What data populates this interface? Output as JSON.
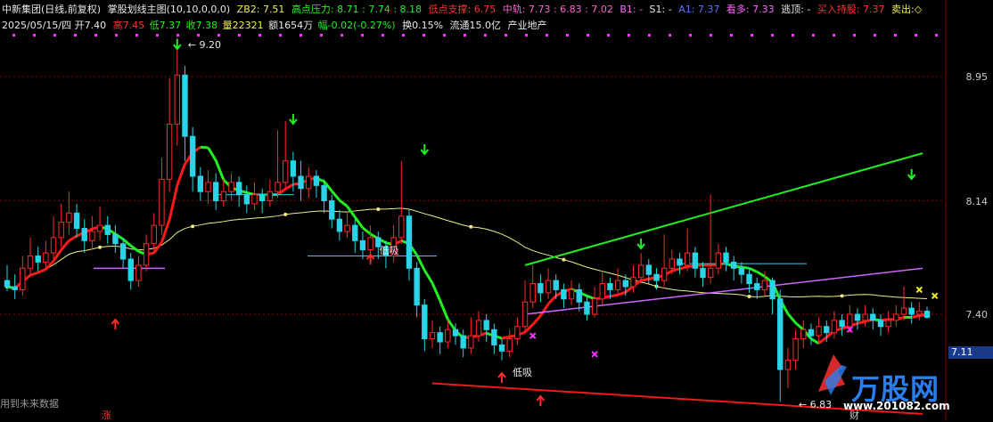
{
  "header": {
    "stock_name": "中新集团(日线,前复权)",
    "indicator_name": "掌股划线主图(10,10,0,0,0)",
    "zb2": "ZB2: 7.51",
    "high_pressure_label": "高点压力:",
    "high_pressure_values": "8.71 : 7.74 : 8.18",
    "low_support": "低点支撑: 6.75",
    "mid_track_label": "中轨:",
    "mid_track_values": "7.73 : 6.83 : 7.02",
    "b1": "B1: -",
    "s1": "S1: -",
    "a1": "A1: 7.37",
    "kan_duo": "看多: 7.33",
    "tao_ding": "逃顶: -",
    "buy_hold": "买入持股: 7.37",
    "sell_out": "卖出:◇"
  },
  "quote": {
    "date": "2025/05/15/四",
    "open": "开7.40",
    "high": "高7.45",
    "low": "低7.37",
    "close": "收7.38",
    "volume": "量22321",
    "amount": "额1654万",
    "change": "幅-0.02(-0.27%)",
    "turnover": "换0.15%",
    "float": "流通15.0亿",
    "sector": "产业地产"
  },
  "footer": {
    "note": "用到未来数据",
    "zhang": "涨",
    "cai": "财"
  },
  "logo": {
    "text": "万股网",
    "url": "www.201082.com"
  },
  "colors": {
    "background": "#000000",
    "up": "#ff2a2a",
    "down": "#2ad4e6",
    "ma_red": "#ff1a1a",
    "ma_green": "#22ee22",
    "long_ma": "#eeee88",
    "channel_upper": "#22ee22",
    "channel_lower": "#ee1a1a",
    "purple_line": "#cc66ff",
    "cyan_line": "#33ccee",
    "grid": "#8b0000"
  },
  "chart_data": {
    "type": "candlestick",
    "y_axis_ticks": [
      "8.95",
      "8.14",
      "7.40"
    ],
    "last_price_label": "7.11",
    "annotations": {
      "high_label": "9.20",
      "low_label": "6.83",
      "low_buy_label_1": "低吸",
      "low_buy_label_2": "低吸"
    },
    "candles": [
      [
        7.62,
        7.58,
        7.72,
        7.55
      ],
      [
        7.58,
        7.56,
        7.66,
        7.5
      ],
      [
        7.56,
        7.7,
        7.78,
        7.52
      ],
      [
        7.7,
        7.78,
        7.9,
        7.66
      ],
      [
        7.78,
        7.74,
        7.84,
        7.68
      ],
      [
        7.74,
        7.8,
        7.88,
        7.7
      ],
      [
        7.8,
        7.9,
        8.04,
        7.76
      ],
      [
        7.9,
        8.0,
        8.12,
        7.84
      ],
      [
        8.0,
        8.06,
        8.2,
        7.92
      ],
      [
        8.06,
        7.96,
        8.12,
        7.9
      ],
      [
        7.96,
        7.88,
        8.02,
        7.8
      ],
      [
        7.88,
        7.94,
        8.04,
        7.82
      ],
      [
        7.94,
        7.98,
        8.1,
        7.88
      ],
      [
        7.98,
        7.92,
        8.04,
        7.86
      ],
      [
        7.92,
        7.86,
        7.98,
        7.8
      ],
      [
        7.86,
        7.76,
        7.9,
        7.7
      ],
      [
        7.76,
        7.62,
        7.8,
        7.56
      ],
      [
        7.62,
        7.72,
        7.78,
        7.58
      ],
      [
        7.72,
        7.86,
        7.92,
        7.68
      ],
      [
        7.86,
        7.98,
        8.06,
        7.8
      ],
      [
        7.98,
        8.28,
        8.42,
        7.92
      ],
      [
        8.28,
        8.64,
        8.94,
        8.2
      ],
      [
        8.64,
        8.96,
        9.2,
        8.5
      ],
      [
        8.96,
        8.56,
        9.02,
        8.4
      ],
      [
        8.56,
        8.3,
        8.62,
        8.2
      ],
      [
        8.3,
        8.2,
        8.36,
        8.14
      ],
      [
        8.2,
        8.26,
        8.34,
        8.12
      ],
      [
        8.26,
        8.14,
        8.32,
        8.08
      ],
      [
        8.14,
        8.2,
        8.28,
        8.1
      ],
      [
        8.2,
        8.26,
        8.32,
        8.14
      ],
      [
        8.26,
        8.18,
        8.3,
        8.1
      ],
      [
        8.18,
        8.12,
        8.24,
        8.06
      ],
      [
        8.12,
        8.18,
        8.26,
        8.08
      ],
      [
        8.18,
        8.14,
        8.22,
        8.06
      ],
      [
        8.14,
        8.2,
        8.28,
        8.1
      ],
      [
        8.2,
        8.26,
        8.6,
        8.16
      ],
      [
        8.26,
        8.4,
        8.66,
        8.22
      ],
      [
        8.4,
        8.3,
        8.46,
        8.2
      ],
      [
        8.3,
        8.22,
        8.4,
        8.14
      ],
      [
        8.22,
        8.3,
        8.36,
        8.16
      ],
      [
        8.3,
        8.24,
        8.34,
        8.16
      ],
      [
        8.24,
        8.14,
        8.28,
        8.06
      ],
      [
        8.14,
        8.02,
        8.18,
        7.96
      ],
      [
        8.02,
        7.94,
        8.08,
        7.88
      ],
      [
        7.94,
        7.98,
        8.06,
        7.9
      ],
      [
        7.98,
        7.88,
        8.02,
        7.8
      ],
      [
        7.88,
        7.82,
        7.94,
        7.76
      ],
      [
        7.82,
        7.9,
        7.98,
        7.78
      ],
      [
        7.9,
        7.84,
        7.94,
        7.76
      ],
      [
        7.84,
        7.78,
        7.88,
        7.7
      ],
      [
        7.78,
        7.9,
        7.98,
        7.74
      ],
      [
        7.9,
        8.04,
        8.4,
        7.86
      ],
      [
        8.04,
        7.7,
        8.08,
        7.62
      ],
      [
        7.7,
        7.46,
        7.74,
        7.38
      ],
      [
        7.46,
        7.24,
        7.5,
        7.16
      ],
      [
        7.24,
        7.28,
        7.36,
        7.18
      ],
      [
        7.28,
        7.22,
        7.32,
        7.14
      ],
      [
        7.22,
        7.3,
        7.36,
        7.18
      ],
      [
        7.3,
        7.26,
        7.34,
        7.2
      ],
      [
        7.26,
        7.18,
        7.3,
        7.12
      ],
      [
        7.18,
        7.26,
        7.38,
        7.14
      ],
      [
        7.26,
        7.36,
        7.42,
        7.22
      ],
      [
        7.36,
        7.3,
        7.4,
        7.22
      ],
      [
        7.3,
        7.2,
        7.34,
        7.14
      ],
      [
        7.2,
        7.16,
        7.24,
        7.1
      ],
      [
        7.16,
        7.24,
        7.3,
        7.12
      ],
      [
        7.24,
        7.32,
        7.38,
        7.2
      ],
      [
        7.32,
        7.48,
        7.62,
        7.28
      ],
      [
        7.48,
        7.6,
        7.72,
        7.44
      ],
      [
        7.6,
        7.54,
        7.66,
        7.48
      ],
      [
        7.54,
        7.62,
        7.7,
        7.5
      ],
      [
        7.62,
        7.56,
        7.66,
        7.5
      ],
      [
        7.56,
        7.5,
        7.6,
        7.44
      ],
      [
        7.5,
        7.56,
        7.62,
        7.46
      ],
      [
        7.56,
        7.48,
        7.6,
        7.42
      ],
      [
        7.48,
        7.4,
        7.52,
        7.36
      ],
      [
        7.4,
        7.5,
        7.58,
        7.38
      ],
      [
        7.5,
        7.6,
        7.68,
        7.46
      ],
      [
        7.6,
        7.56,
        7.64,
        7.5
      ],
      [
        7.56,
        7.62,
        7.7,
        7.52
      ],
      [
        7.62,
        7.58,
        7.66,
        7.52
      ],
      [
        7.58,
        7.64,
        7.72,
        7.54
      ],
      [
        7.64,
        7.72,
        7.8,
        7.6
      ],
      [
        7.72,
        7.66,
        7.76,
        7.6
      ],
      [
        7.66,
        7.62,
        7.7,
        7.56
      ],
      [
        7.62,
        7.7,
        7.92,
        7.58
      ],
      [
        7.7,
        7.76,
        7.82,
        7.66
      ],
      [
        7.76,
        7.72,
        7.8,
        7.66
      ],
      [
        7.72,
        7.8,
        7.96,
        7.68
      ],
      [
        7.8,
        7.7,
        7.84,
        7.64
      ],
      [
        7.7,
        7.64,
        7.74,
        7.58
      ],
      [
        7.64,
        7.7,
        8.18,
        7.6
      ],
      [
        7.7,
        7.8,
        7.86,
        7.66
      ],
      [
        7.8,
        7.74,
        7.84,
        7.68
      ],
      [
        7.74,
        7.7,
        7.78,
        7.62
      ],
      [
        7.7,
        7.66,
        7.74,
        7.6
      ],
      [
        7.66,
        7.6,
        7.7,
        7.54
      ],
      [
        7.6,
        7.56,
        7.64,
        7.5
      ],
      [
        7.56,
        7.62,
        7.68,
        7.52
      ],
      [
        7.62,
        7.5,
        7.64,
        7.4
      ],
      [
        7.5,
        7.04,
        7.56,
        6.83
      ],
      [
        7.04,
        7.1,
        7.18,
        6.92
      ],
      [
        7.1,
        7.24,
        7.3,
        7.04
      ],
      [
        7.24,
        7.3,
        7.36,
        7.18
      ],
      [
        7.3,
        7.26,
        7.34,
        7.2
      ],
      [
        7.26,
        7.32,
        7.38,
        7.22
      ],
      [
        7.32,
        7.28,
        7.36,
        7.22
      ],
      [
        7.28,
        7.36,
        7.42,
        7.24
      ],
      [
        7.36,
        7.32,
        7.4,
        7.26
      ],
      [
        7.32,
        7.4,
        7.46,
        7.28
      ],
      [
        7.4,
        7.36,
        7.44,
        7.3
      ],
      [
        7.36,
        7.4,
        7.46,
        7.32
      ],
      [
        7.4,
        7.36,
        7.44,
        7.3
      ],
      [
        7.36,
        7.32,
        7.4,
        7.26
      ],
      [
        7.32,
        7.36,
        7.42,
        7.28
      ],
      [
        7.36,
        7.4,
        7.46,
        7.32
      ],
      [
        7.4,
        7.44,
        7.58,
        7.36
      ],
      [
        7.44,
        7.4,
        7.48,
        7.34
      ],
      [
        7.4,
        7.42,
        7.48,
        7.36
      ],
      [
        7.42,
        7.38,
        7.45,
        7.37
      ]
    ]
  }
}
